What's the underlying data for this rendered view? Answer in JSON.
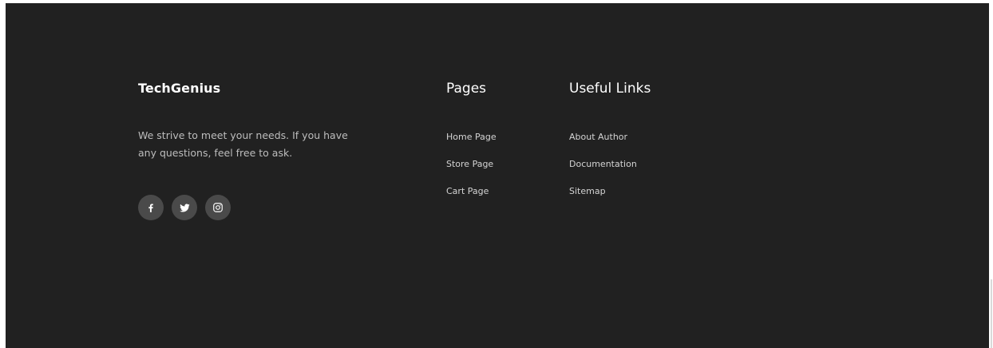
{
  "brand": {
    "name": "TechGenius"
  },
  "about": {
    "text": "We strive to meet your needs. If you have any questions, feel free to ask."
  },
  "social": [
    {
      "icon": "facebook-icon"
    },
    {
      "icon": "twitter-icon"
    },
    {
      "icon": "instagram-icon"
    }
  ],
  "pages": {
    "heading": "Pages",
    "links": [
      "Home Page",
      "Store Page",
      "Cart Page"
    ]
  },
  "useful": {
    "heading": "Useful Links",
    "links": [
      "About Author",
      "Documentation",
      "Sitemap"
    ]
  },
  "colors": {
    "footer_bg": "#212121",
    "icon_bg": "#4a4a4a",
    "heading": "#ffffff",
    "text": "#bdbdbd"
  }
}
